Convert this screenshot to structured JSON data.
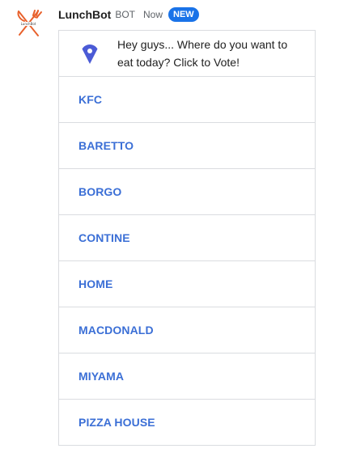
{
  "message": {
    "sender": "LunchBot",
    "tag": "BOT",
    "time": "Now",
    "badge": "NEW",
    "avatar_icon": "crossed-fork-knife-icon",
    "card": {
      "icon": "location-pin-icon",
      "text": "Hey guys... Where do you want to eat today? Click to Vote!",
      "options": [
        "KFC",
        "BARETTO",
        "BORGO",
        "CONTINE",
        "HOME",
        "MACDONALD",
        "MIYAMA",
        "PIZZA HOUSE"
      ]
    }
  },
  "colors": {
    "accent": "#1a73e8",
    "option_text": "#3b6fd6",
    "avatar": "#e8612c",
    "pin": "#4b5bd6",
    "border": "#dadce0"
  }
}
